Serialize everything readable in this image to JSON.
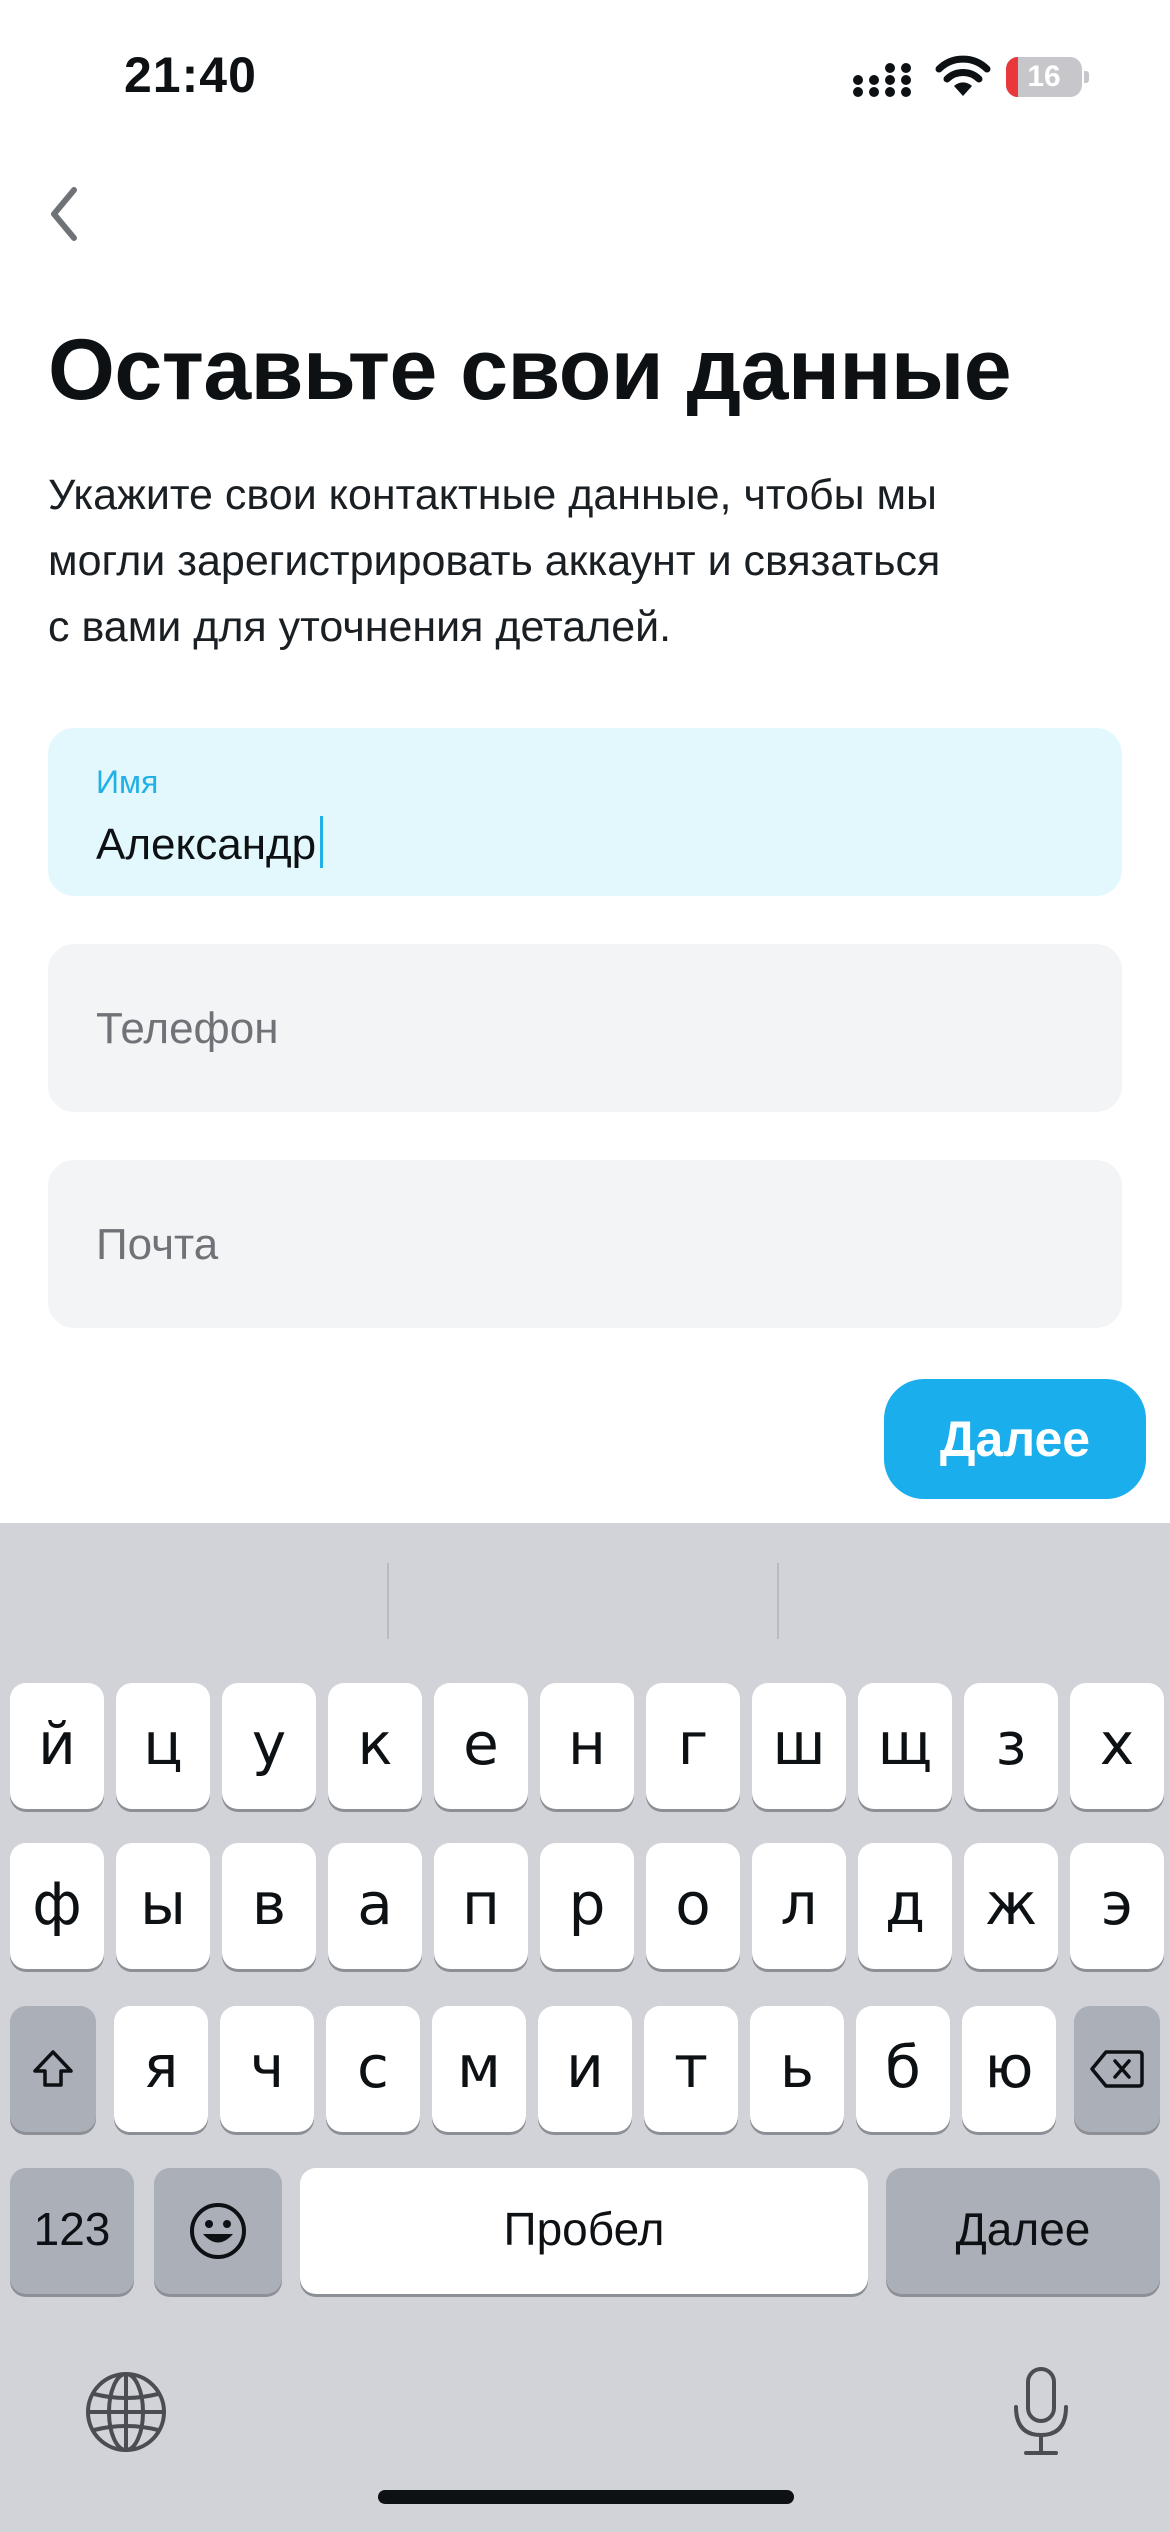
{
  "status_bar": {
    "time": "21:40",
    "battery_level": "16",
    "battery_fraction": 0.16,
    "icons": [
      "signal-icon",
      "wifi-icon",
      "battery-icon"
    ]
  },
  "nav": {
    "back_icon": "chevron-left-icon"
  },
  "header": {
    "title": "Оставьте свои данные",
    "subtitle_lines": [
      "Укажите свои контактные данные, чтобы мы",
      "могли зарегистрировать аккаунт и связаться",
      "с вами для уточнения деталей."
    ]
  },
  "form": {
    "name": {
      "label": "Имя",
      "value": "Александр"
    },
    "phone": {
      "placeholder": "Телефон"
    },
    "email": {
      "placeholder": "Почта"
    }
  },
  "actions": {
    "next_label": "Далее"
  },
  "keyboard": {
    "rows": [
      [
        "й",
        "ц",
        "у",
        "к",
        "е",
        "н",
        "г",
        "ш",
        "щ",
        "з",
        "х"
      ],
      [
        "ф",
        "ы",
        "в",
        "а",
        "п",
        "р",
        "о",
        "л",
        "д",
        "ж",
        "э"
      ],
      [
        "я",
        "ч",
        "с",
        "м",
        "и",
        "т",
        "ь",
        "б",
        "ю"
      ]
    ],
    "numbers_label": "123",
    "space_label": "Пробел",
    "return_label": "Далее",
    "icons": [
      "shift-icon",
      "backspace-icon",
      "emoji-icon",
      "globe-icon",
      "microphone-icon"
    ]
  },
  "colors": {
    "accent": "#1aaeec",
    "active_field_bg": "#e3f8fd",
    "field_bg": "#f3f4f6",
    "keyboard_bg": "#d2d3d9"
  }
}
